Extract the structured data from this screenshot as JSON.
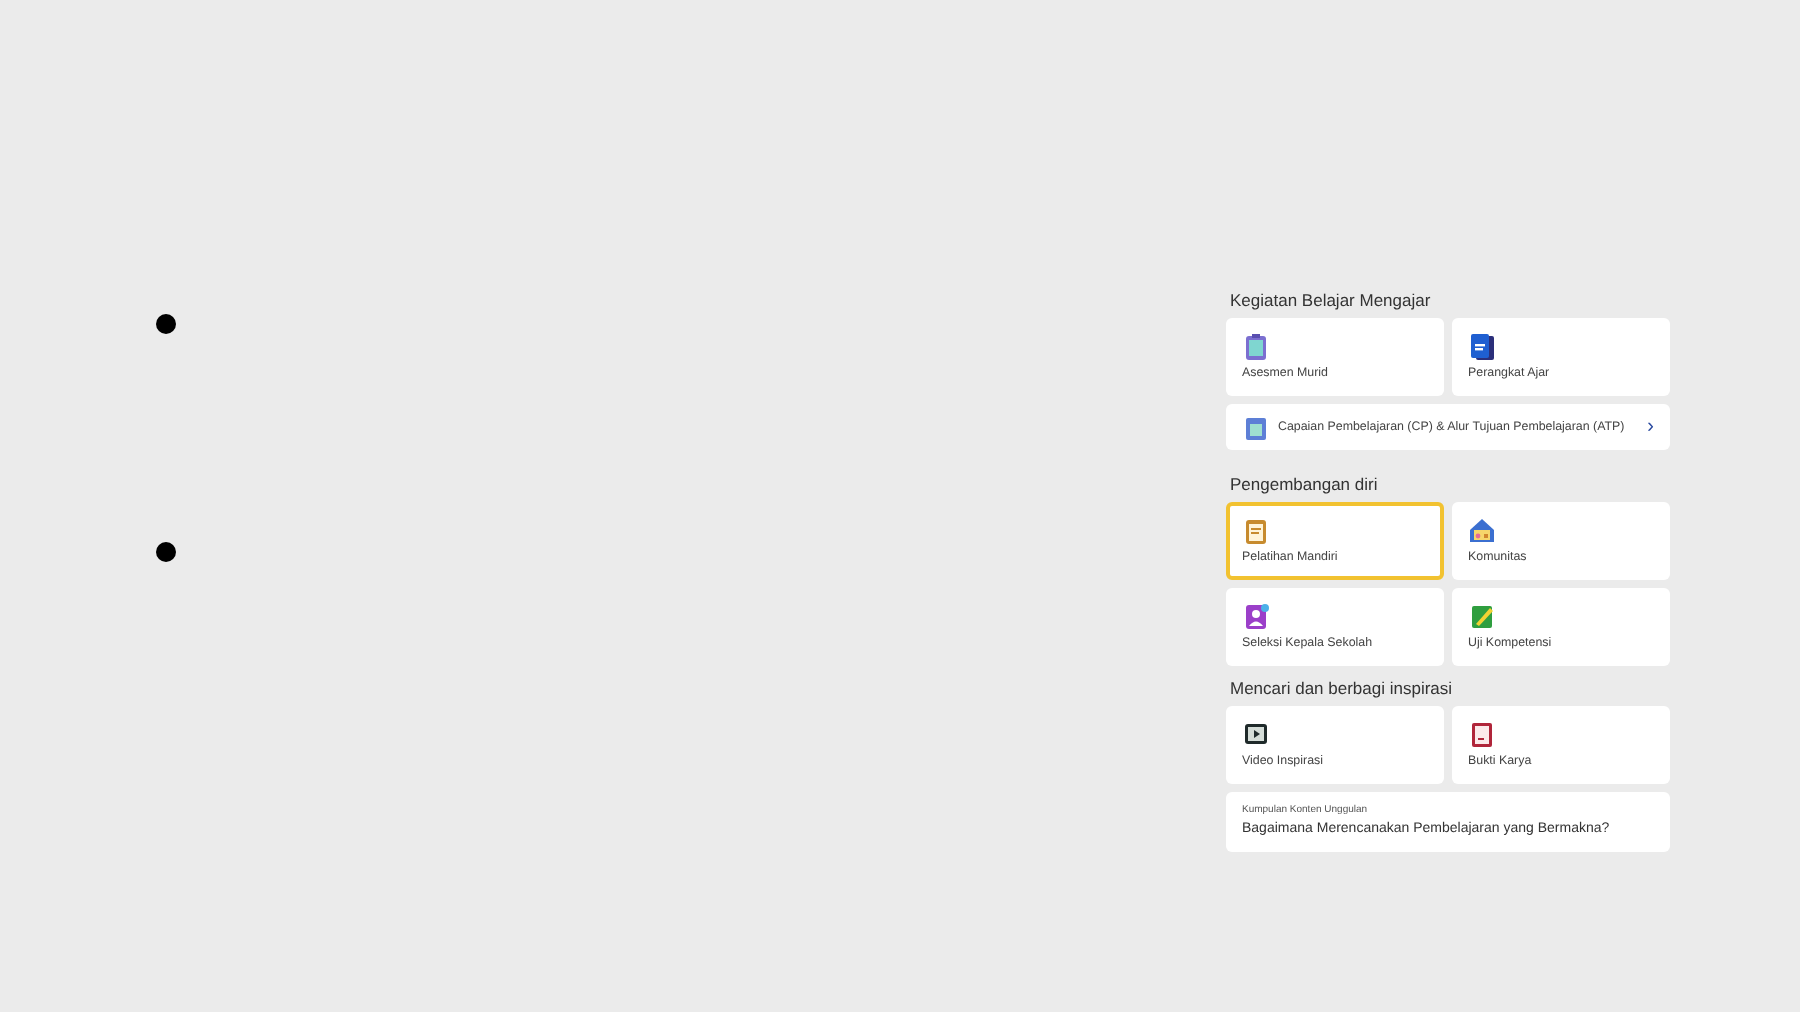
{
  "bullets": [
    {
      "kind": "dot"
    },
    {
      "kind": "dot"
    }
  ],
  "sections": [
    {
      "title": "Kegiatan Belajar Mengajar",
      "items": [
        {
          "kind": "tile",
          "label": "Asesmen Murid",
          "selected": false
        },
        {
          "kind": "tile",
          "label": "Perangkat Ajar",
          "selected": false
        },
        {
          "kind": "row",
          "label": "Capaian Pembelajaran (CP) & Alur Tujuan Pembelajaran (ATP)",
          "chevron": "›",
          "selected": false
        }
      ]
    },
    {
      "title": "Pengembangan diri",
      "items": [
        {
          "kind": "tile",
          "label": "Pelatihan Mandiri",
          "selected": true
        },
        {
          "kind": "tile",
          "label": "Komunitas",
          "selected": false
        },
        {
          "kind": "tile",
          "label": "Seleksi Kepala Sekolah",
          "selected": false
        },
        {
          "kind": "tile",
          "label": "Uji Kompetensi",
          "selected": false
        }
      ]
    },
    {
      "title": "Mencari dan berbagi inspirasi",
      "items": [
        {
          "kind": "tile",
          "label": "Video Inspirasi",
          "selected": false
        },
        {
          "kind": "tile",
          "label": "Bukti Karya",
          "selected": false
        },
        {
          "kind": "feature",
          "caption": "Kumpulan Konten Unggulan",
          "label": "Bagaimana Merencanakan Pembelajaran yang Bermakna?",
          "selected": false
        }
      ]
    }
  ]
}
